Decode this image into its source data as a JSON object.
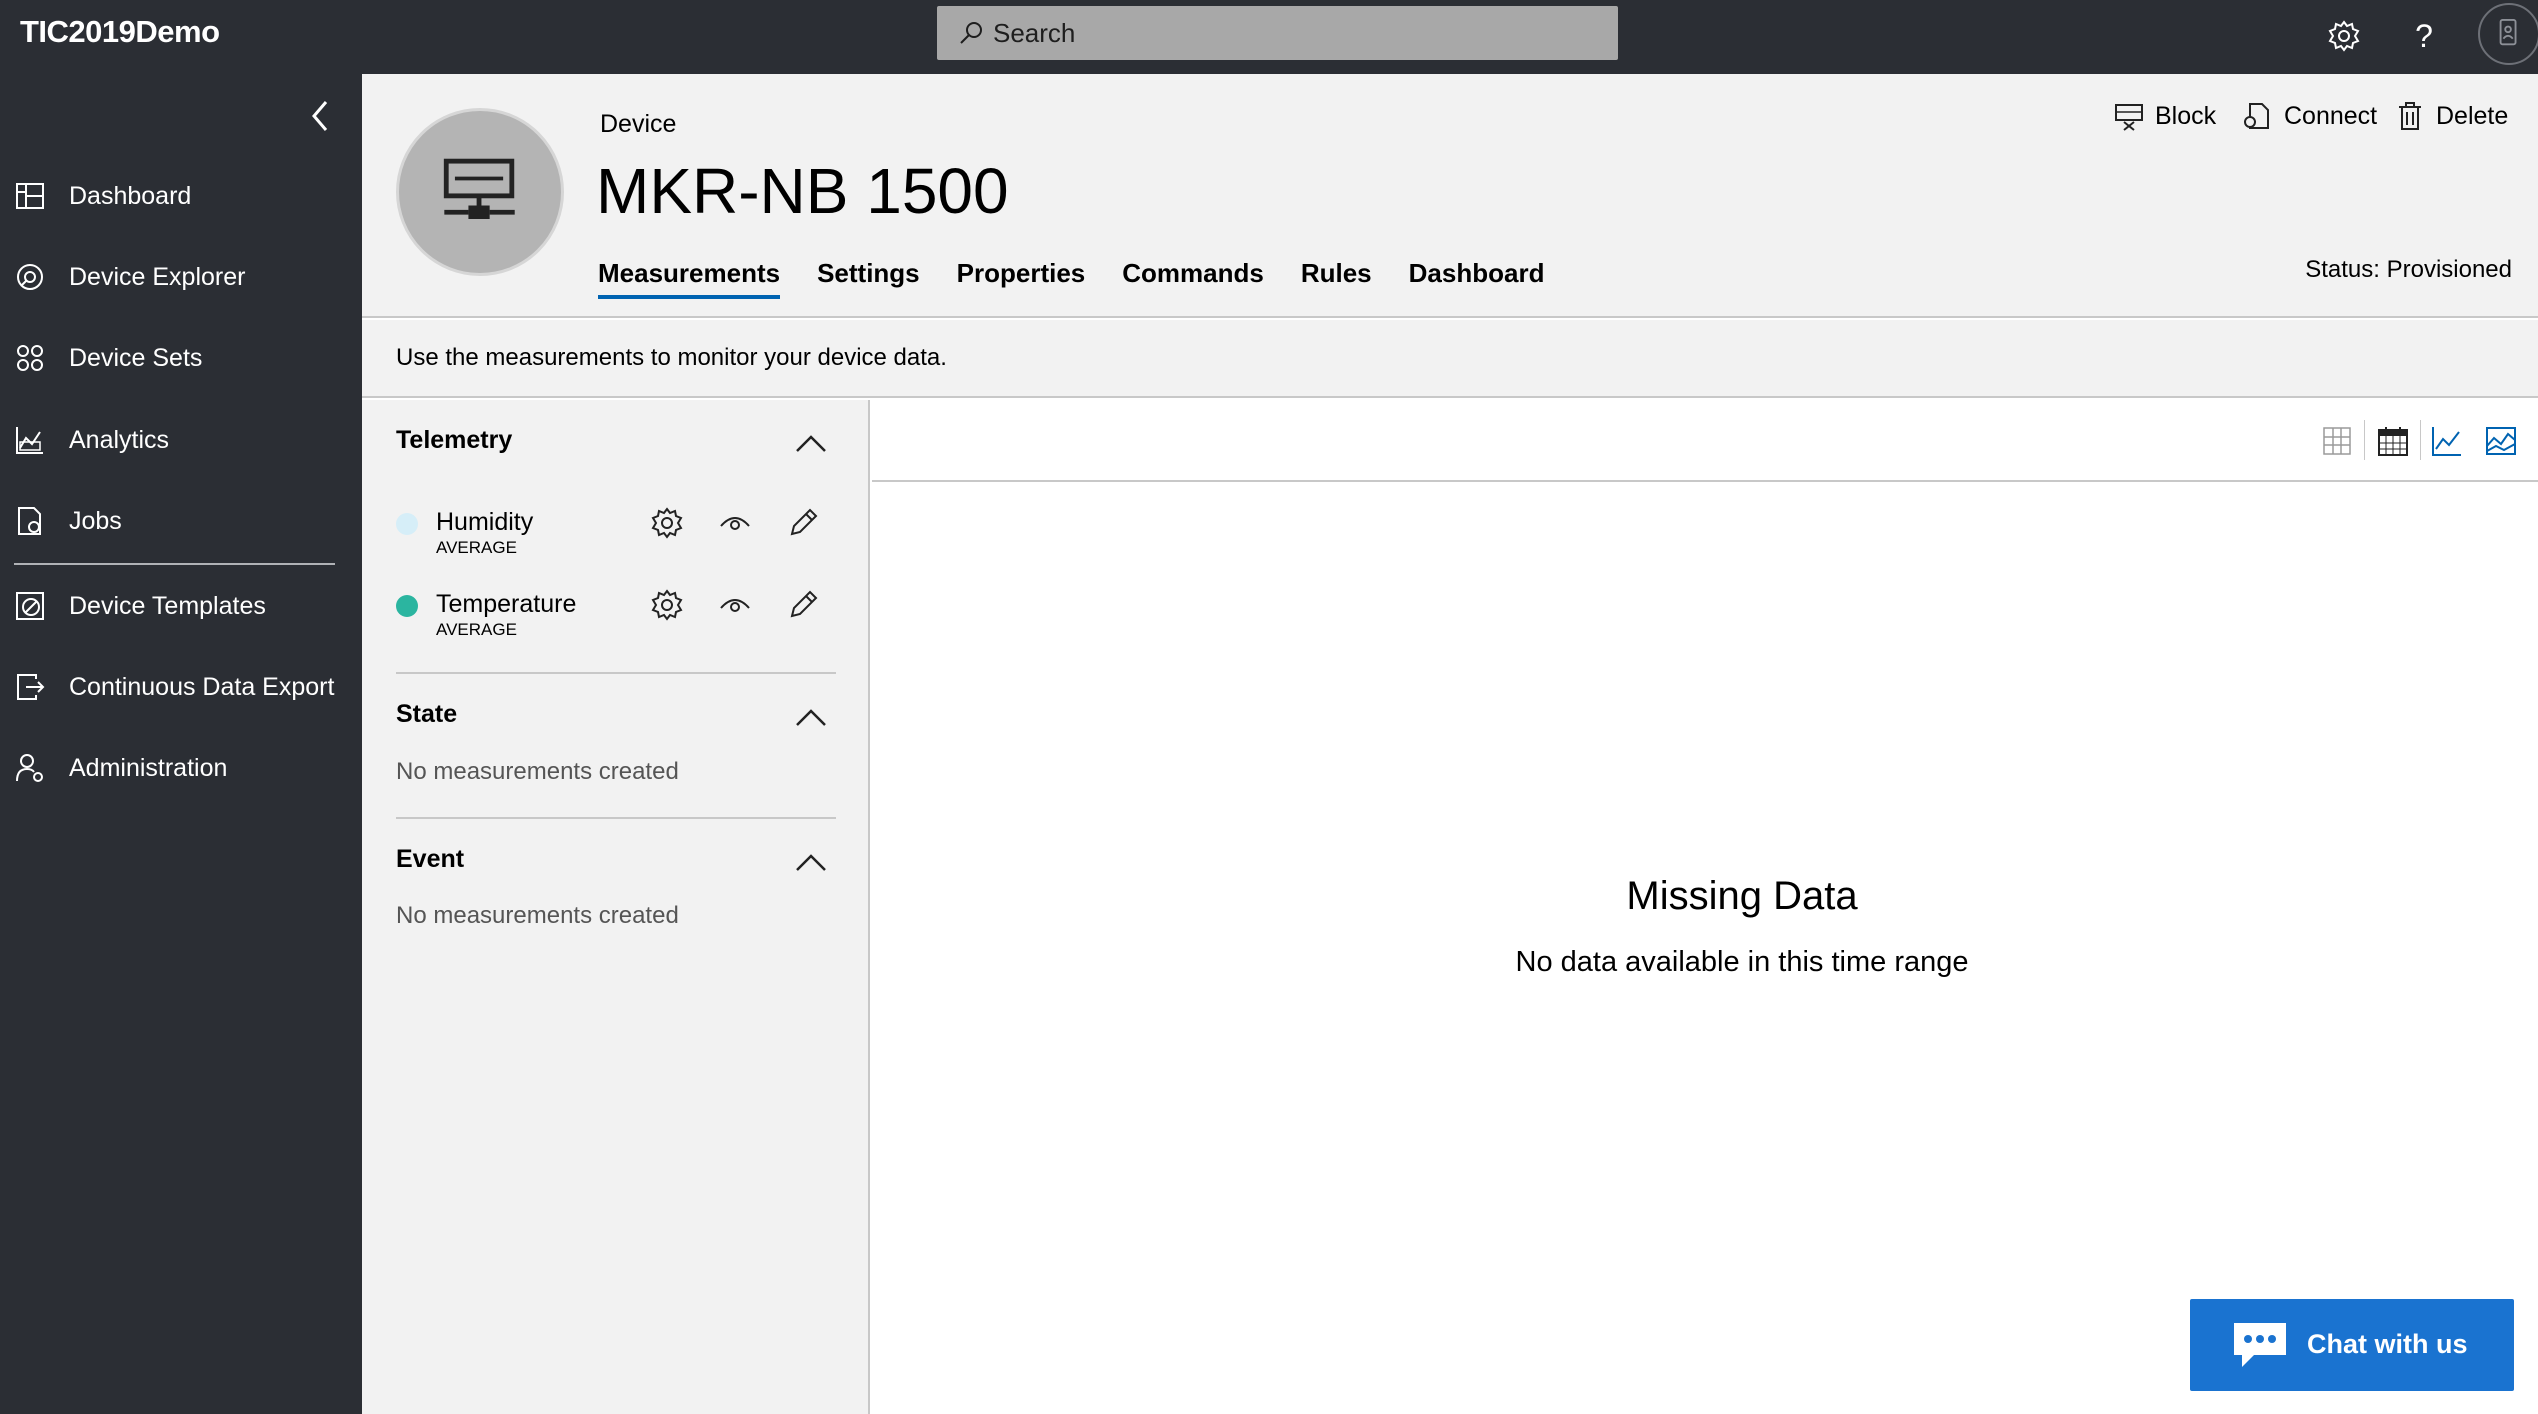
{
  "app": {
    "title": "TIC2019Demo"
  },
  "search": {
    "placeholder": "Search"
  },
  "sidebar": {
    "items": [
      {
        "label": "Dashboard",
        "icon": "dashboard-icon"
      },
      {
        "label": "Device Explorer",
        "icon": "device-explorer-icon"
      },
      {
        "label": "Device Sets",
        "icon": "device-sets-icon"
      },
      {
        "label": "Analytics",
        "icon": "analytics-icon"
      },
      {
        "label": "Jobs",
        "icon": "jobs-icon"
      },
      {
        "label": "Device Templates",
        "icon": "device-templates-icon"
      },
      {
        "label": "Continuous Data Export",
        "icon": "data-export-icon"
      },
      {
        "label": "Administration",
        "icon": "administration-icon"
      }
    ]
  },
  "device": {
    "label": "Device",
    "name": "MKR-NB 1500",
    "status": "Status: Provisioned",
    "tabs": [
      "Measurements",
      "Settings",
      "Properties",
      "Commands",
      "Rules",
      "Dashboard"
    ],
    "active_tab": "Measurements"
  },
  "actions": {
    "block": "Block",
    "connect": "Connect",
    "delete": "Delete"
  },
  "description": "Use the measurements to monitor your device data.",
  "measurements": {
    "telemetry": {
      "title": "Telemetry",
      "items": [
        {
          "name": "Humidity",
          "aggregation": "AVERAGE",
          "color": "#d6eef8"
        },
        {
          "name": "Temperature",
          "aggregation": "AVERAGE",
          "color": "#2bb5a0"
        }
      ]
    },
    "state": {
      "title": "State",
      "empty": "No measurements created"
    },
    "event": {
      "title": "Event",
      "empty": "No measurements created"
    }
  },
  "chart_area": {
    "title": "Missing Data",
    "subtitle": "No data available in this time range"
  },
  "chat": {
    "label": "Chat with us"
  },
  "colors": {
    "topbar": "#2b2e34",
    "accent": "#0063b1",
    "chat": "#1a73d0"
  }
}
